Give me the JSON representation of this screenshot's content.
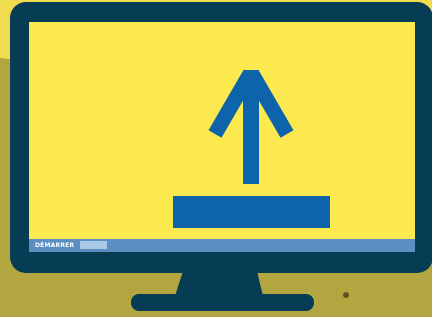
{
  "screen": {
    "taskbar": {
      "start_label": "DÉMARRER"
    },
    "icon": "upload-arrow-icon"
  },
  "colors": {
    "background_yellow": "#f1db4e",
    "background_olive": "#b3a640",
    "monitor_frame": "#063d55",
    "screen_fill": "#fbe94f",
    "upload_icon": "#0e64ab",
    "taskbar": "#5b8fc2"
  }
}
